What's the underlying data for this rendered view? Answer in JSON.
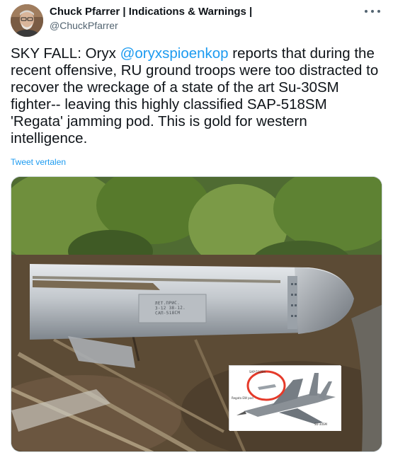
{
  "author": {
    "name": "Chuck Pfarrer | Indications & Warnings |",
    "handle": "@ChuckPfarrer",
    "avatar_icon": "profile-photo"
  },
  "more_icon": "more-horizontal-icon",
  "tweet": {
    "text_part1": "SKY FALL: Oryx ",
    "mention": "@oryxspioenkop",
    "text_part2": " reports that during the recent offensive, RU ground troops were too distracted to recover the wreckage of a state of the art Su-30SM fighter-- leaving this highly classified SAP-518SM 'Regata' jamming pod. This is gold for western intelligence.",
    "translate_label": "Tweet vertalen"
  },
  "media": {
    "pod_marking": "ЛЕТ.ПРИС.\nЗ-12 38-12.\nСАП-518СМ",
    "inset": {
      "label_top": "SAP-518SM",
      "label_left": "Regata EW pod",
      "label_bottom": "SU-30SM"
    }
  },
  "colors": {
    "link": "#1d9bf0",
    "text": "#0f1419",
    "secondary": "#536471",
    "highlight_circle": "#e53a2a"
  }
}
